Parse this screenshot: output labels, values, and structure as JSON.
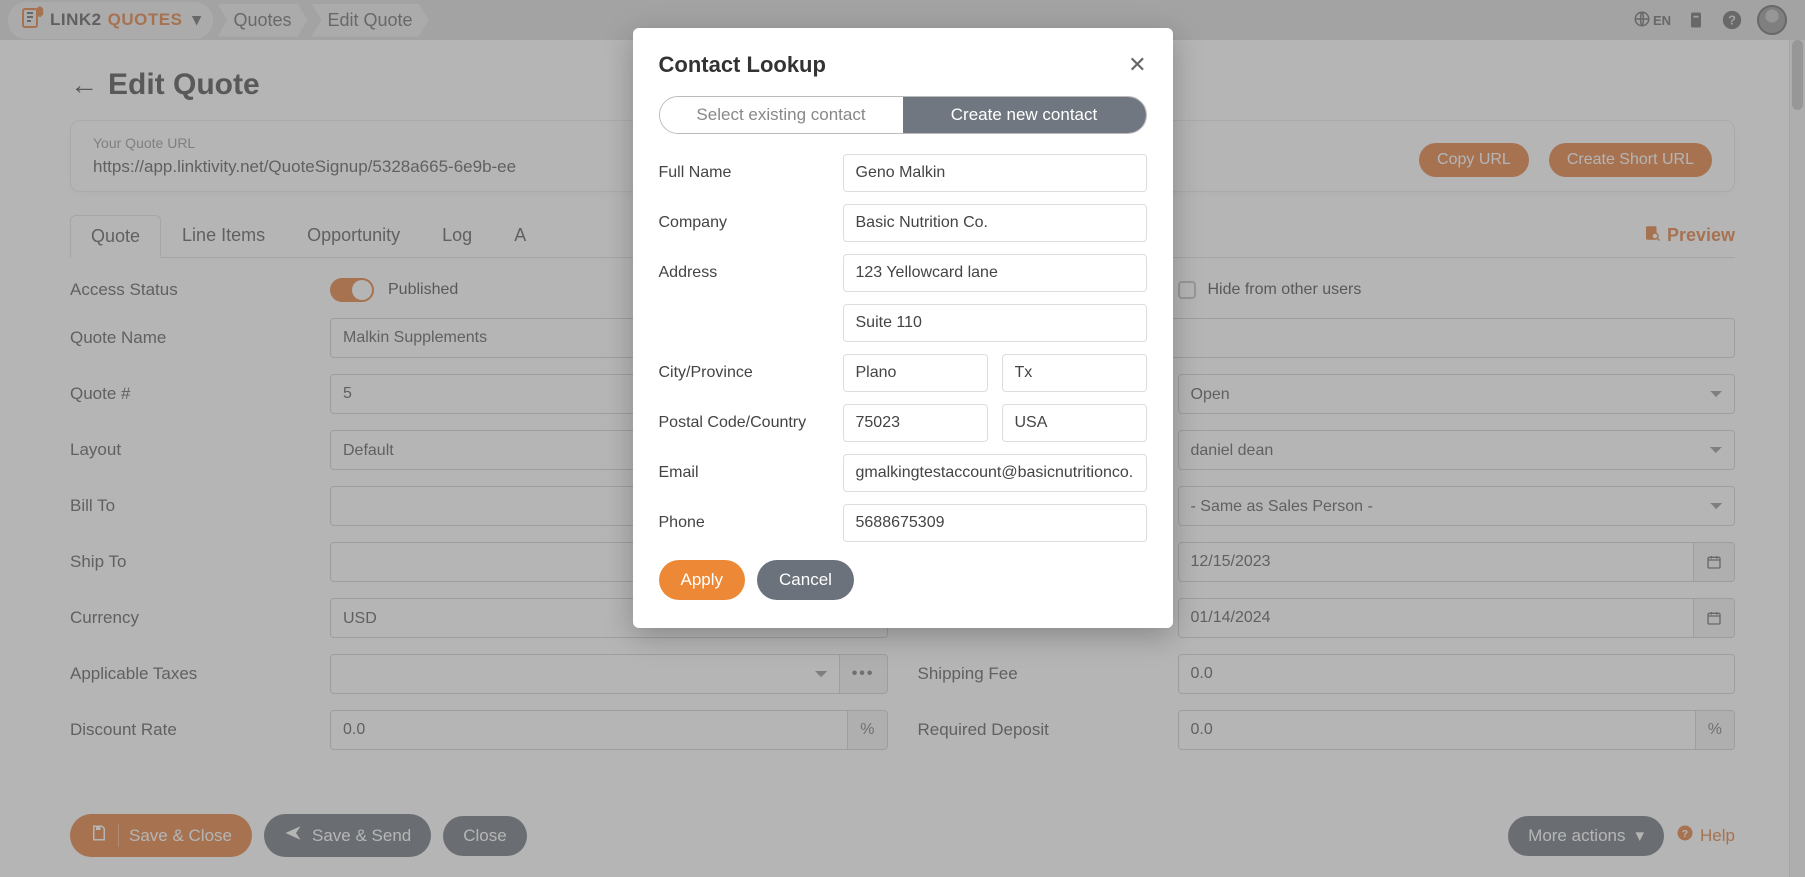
{
  "brand": {
    "part1": "LINK2",
    "part2": "QUOTES"
  },
  "breadcrumbs": [
    "Quotes",
    "Edit Quote"
  ],
  "topbar": {
    "lang": "EN"
  },
  "page": {
    "title": "Edit Quote",
    "url_label": "Your Quote URL",
    "url_value": "https://app.linktivity.net/QuoteSignup/5328a665-6e9b-ee",
    "copy_btn": "Copy URL",
    "short_btn": "Create Short URL"
  },
  "tabs": {
    "items": [
      "Quote",
      "Line Items",
      "Opportunity",
      "Log",
      "A"
    ],
    "active": 0,
    "preview": "Preview"
  },
  "form": {
    "access_status_label": "Access Status",
    "access_status_value": "Published",
    "hide_label": "Hide from other users",
    "quote_name_label": "Quote Name",
    "quote_name_value": "Malkin Supplements",
    "quote_num_label": "Quote #",
    "quote_num_value": "5",
    "status_value": "Open",
    "layout_label": "Layout",
    "layout_value": "Default",
    "salesperson_value": "daniel dean",
    "bill_to_label": "Bill To",
    "bill_to_value": "",
    "bill_to_right_value": "- Same as Sales Person -",
    "ship_to_label": "Ship To",
    "ship_to_value": "",
    "date1_value": "12/15/2023",
    "currency_label": "Currency",
    "currency_value": "USD",
    "date2_value": "01/14/2024",
    "taxes_label": "Applicable Taxes",
    "taxes_value": "",
    "shipping_label": "Shipping Fee",
    "shipping_value": "0.0",
    "discount_label": "Discount Rate",
    "discount_value": "0.0",
    "deposit_label": "Required Deposit",
    "deposit_value": "0.0",
    "pct": "%"
  },
  "footer": {
    "save_close": "Save & Close",
    "save_send": "Save & Send",
    "close": "Close",
    "more": "More actions",
    "help": "Help"
  },
  "modal": {
    "title": "Contact Lookup",
    "tab_existing": "Select existing contact",
    "tab_new": "Create new contact",
    "full_name_label": "Full Name",
    "full_name_value": "Geno Malkin",
    "company_label": "Company",
    "company_value": "Basic Nutrition Co.",
    "address_label": "Address",
    "address1_value": "123 Yellowcard lane",
    "address2_value": "Suite 110",
    "city_label": "City/Province",
    "city_value": "Plano",
    "province_value": "Tx",
    "postal_label": "Postal Code/Country",
    "postal_value": "75023",
    "country_value": "USA",
    "email_label": "Email",
    "email_value": "gmalkingtestaccount@basicnutritionco.com",
    "phone_label": "Phone",
    "phone_value": "5688675309",
    "apply": "Apply",
    "cancel": "Cancel"
  }
}
